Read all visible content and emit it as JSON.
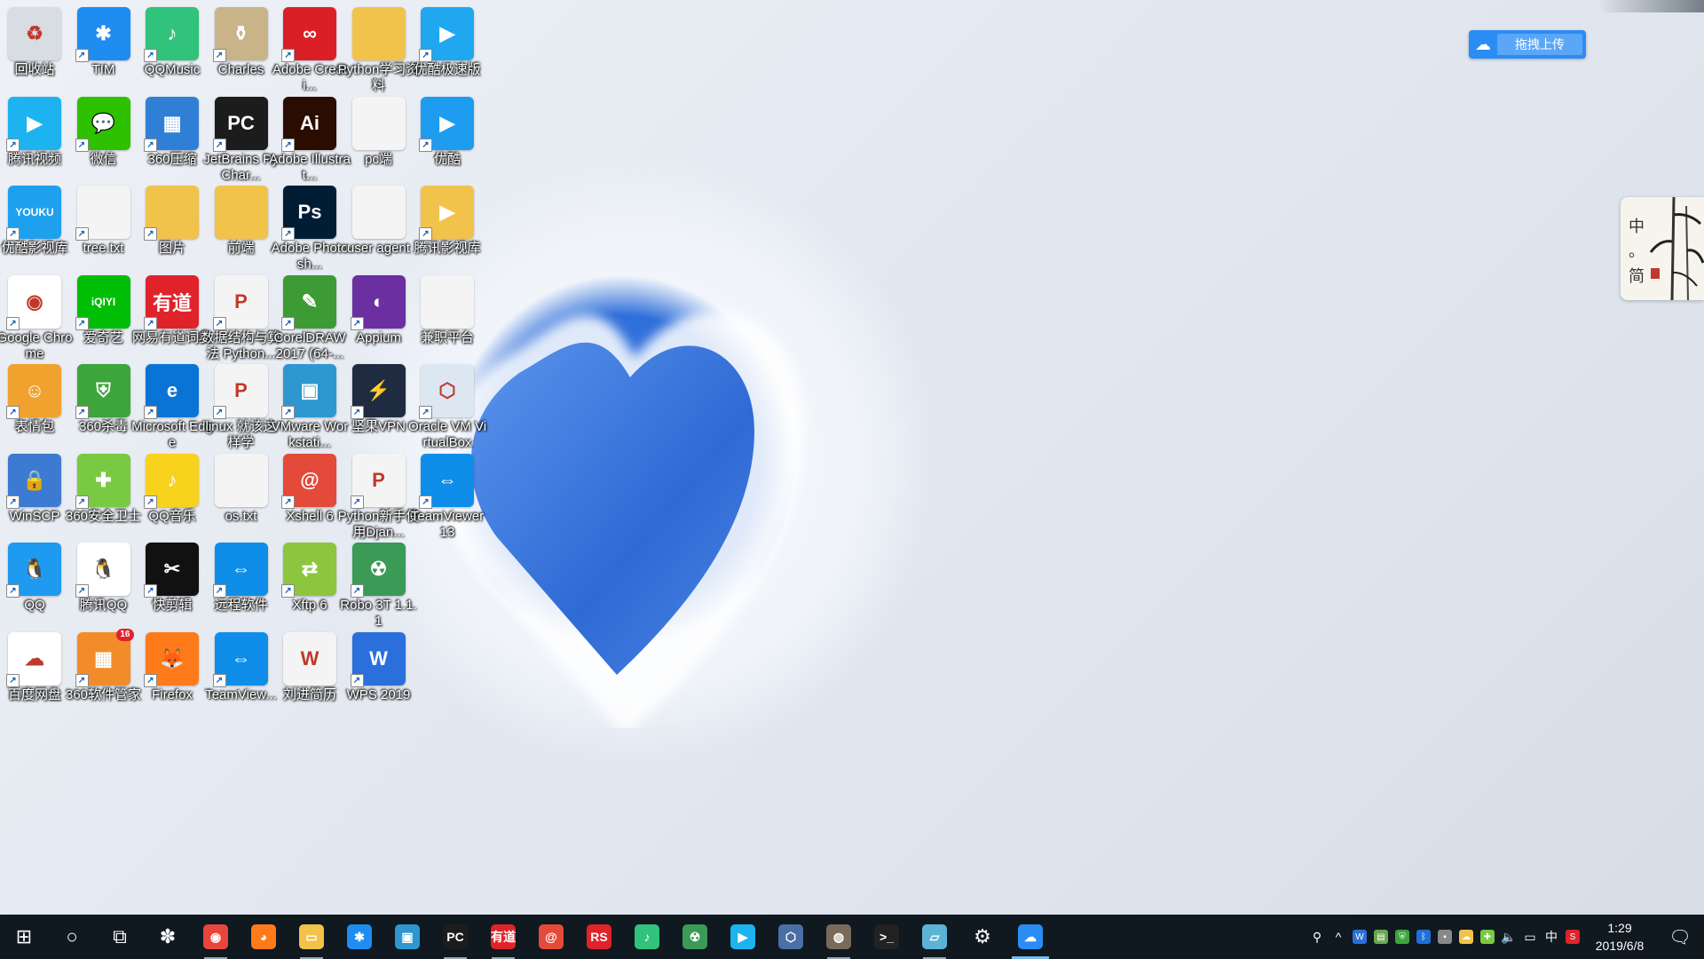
{
  "desktop": {
    "icons": [
      {
        "label": "回收站",
        "icon": "recycle-bin-icon",
        "color": "#d8dde3",
        "glyph": "♻",
        "shortcut": false
      },
      {
        "label": "TIM",
        "icon": "tim-icon",
        "color": "#1e8cf0",
        "glyph": "✱",
        "shortcut": true
      },
      {
        "label": "QQMusic",
        "icon": "qqmusic-icon",
        "color": "#31c27c",
        "glyph": "♪",
        "shortcut": true
      },
      {
        "label": "Charles",
        "icon": "charles-icon",
        "color": "#c9b48a",
        "glyph": "⚱",
        "shortcut": true
      },
      {
        "label": "Adobe Creati...",
        "icon": "adobe-creative-cloud-icon",
        "color": "#da1f26",
        "glyph": "∞",
        "shortcut": true
      },
      {
        "label": "Python学习资料",
        "icon": "folder-icon",
        "color": "#f1c34a",
        "glyph": "",
        "shortcut": false
      },
      {
        "label": "优酷极速版",
        "icon": "youku-express-icon",
        "color": "#1fa8f0",
        "glyph": "▶",
        "shortcut": true
      },
      {
        "label": "腾讯视频",
        "icon": "tencent-video-icon",
        "color": "#1db3f0",
        "glyph": "▶",
        "shortcut": true
      },
      {
        "label": "微信",
        "icon": "wechat-icon",
        "color": "#2dc100",
        "glyph": "💬",
        "shortcut": true
      },
      {
        "label": "360压缩",
        "icon": "360zip-icon",
        "color": "#2f7fd6",
        "glyph": "▦",
        "shortcut": true
      },
      {
        "label": "JetBrains PyChar...",
        "icon": "pycharm-icon",
        "color": "#1c1c1c",
        "glyph": "PC",
        "shortcut": true
      },
      {
        "label": "Adobe Illustrat...",
        "icon": "illustrator-icon",
        "color": "#2b0c00",
        "glyph": "Ai",
        "shortcut": true
      },
      {
        "label": "pc端",
        "icon": "file-icon",
        "color": "#f4f4f4",
        "glyph": "",
        "shortcut": false
      },
      {
        "label": "优酷",
        "icon": "youku-icon",
        "color": "#1d9cf0",
        "glyph": "▶",
        "shortcut": true
      },
      {
        "label": "优酷影视库",
        "icon": "youku-library-icon",
        "color": "#1fa0ef",
        "glyph": "YOUKU",
        "shortcut": true
      },
      {
        "label": "tree.txt",
        "icon": "text-file-icon",
        "color": "#f4f4f4",
        "glyph": "",
        "shortcut": true
      },
      {
        "label": "图片",
        "icon": "pictures-folder-icon",
        "color": "#f1c34a",
        "glyph": "",
        "shortcut": true
      },
      {
        "label": "前端",
        "icon": "zip-folder-icon",
        "color": "#f1c34a",
        "glyph": "",
        "shortcut": false
      },
      {
        "label": "Adobe Photosh...",
        "icon": "photoshop-icon",
        "color": "#001d34",
        "glyph": "Ps",
        "shortcut": true
      },
      {
        "label": "user agent",
        "icon": "file-icon",
        "color": "#f4f4f4",
        "glyph": "",
        "shortcut": false
      },
      {
        "label": "腾讯影视库",
        "icon": "tencent-video-library-icon",
        "color": "#f1c34a",
        "glyph": "▶",
        "shortcut": true
      },
      {
        "label": "Google Chrome",
        "icon": "chrome-icon",
        "color": "#ffffff",
        "glyph": "◉",
        "shortcut": true
      },
      {
        "label": "爱奇艺",
        "icon": "iqiyi-icon",
        "color": "#00be06",
        "glyph": "iQIYI",
        "shortcut": true
      },
      {
        "label": "网易有道词典",
        "icon": "youdao-icon",
        "color": "#e0232b",
        "glyph": "有道",
        "shortcut": true
      },
      {
        "label": "数据结构与算法 Python...",
        "icon": "pdf-icon",
        "color": "#f4f4f4",
        "glyph": "P",
        "shortcut": true
      },
      {
        "label": "CorelDRAW 2017 (64-...",
        "icon": "coreldraw-icon",
        "color": "#3d9b36",
        "glyph": "✎",
        "shortcut": true
      },
      {
        "label": "Appium",
        "icon": "appium-icon",
        "color": "#6b2fa1",
        "glyph": "◐",
        "shortcut": true
      },
      {
        "label": "兼职平台",
        "icon": "file-icon",
        "color": "#f4f4f4",
        "glyph": "",
        "shortcut": false
      },
      {
        "label": "表情包",
        "icon": "emoji-pack-icon",
        "color": "#f1a22e",
        "glyph": "☺",
        "shortcut": true
      },
      {
        "label": "360杀毒",
        "icon": "360antivirus-icon",
        "color": "#3da53b",
        "glyph": "⛨",
        "shortcut": true
      },
      {
        "label": "Microsoft Edge",
        "icon": "edge-icon",
        "color": "#0a74d6",
        "glyph": "e",
        "shortcut": true
      },
      {
        "label": "linux 就该这样学",
        "icon": "pdf-icon",
        "color": "#f4f4f4",
        "glyph": "P",
        "shortcut": true
      },
      {
        "label": "VMware Workstati...",
        "icon": "vmware-icon",
        "color": "#2f97d0",
        "glyph": "▣",
        "shortcut": true
      },
      {
        "label": "坚果VPN",
        "icon": "vpn-icon",
        "color": "#1f2b40",
        "glyph": "⚡",
        "shortcut": true
      },
      {
        "label": "Oracle VM VirtualBox",
        "icon": "virtualbox-icon",
        "color": "#dde7f2",
        "glyph": "⬡",
        "shortcut": true
      },
      {
        "label": "WinSCP",
        "icon": "winscp-icon",
        "color": "#3c7bd1",
        "glyph": "🔒",
        "shortcut": true
      },
      {
        "label": "360安全卫士",
        "icon": "360security-icon",
        "color": "#7ac943",
        "glyph": "✚",
        "shortcut": true
      },
      {
        "label": "QQ音乐",
        "icon": "qqmusic-icon",
        "color": "#f8d21c",
        "glyph": "♪",
        "shortcut": true
      },
      {
        "label": "os.txt",
        "icon": "text-file-icon",
        "color": "#f4f4f4",
        "glyph": "",
        "shortcut": false
      },
      {
        "label": "Xshell 6",
        "icon": "xshell-icon",
        "color": "#e34a3a",
        "glyph": "@",
        "shortcut": true
      },
      {
        "label": "Python新手使用Djan...",
        "icon": "pdf-icon",
        "color": "#f4f4f4",
        "glyph": "P",
        "shortcut": true
      },
      {
        "label": "TeamViewer 13",
        "icon": "teamviewer-icon",
        "color": "#0e8ee9",
        "glyph": "⇔",
        "shortcut": true
      },
      {
        "label": "QQ",
        "icon": "qq-icon",
        "color": "#1e9af0",
        "glyph": "🐧",
        "shortcut": true
      },
      {
        "label": "腾讯QQ",
        "icon": "tencent-qq-icon",
        "color": "#ffffff",
        "glyph": "🐧",
        "shortcut": true
      },
      {
        "label": "快剪辑",
        "icon": "kuaijianji-icon",
        "color": "#111111",
        "glyph": "✂",
        "shortcut": true
      },
      {
        "label": "远程软件",
        "icon": "remote-software-icon",
        "color": "#0e8ee9",
        "glyph": "⇔",
        "shortcut": true
      },
      {
        "label": "Xftp 6",
        "icon": "xftp-icon",
        "color": "#8cc63f",
        "glyph": "⇄",
        "shortcut": true
      },
      {
        "label": "Robo 3T 1.1.1",
        "icon": "robo3t-icon",
        "color": "#3a9a56",
        "glyph": "☢",
        "shortcut": true
      },
      {
        "label": "",
        "icon": "",
        "color": "",
        "glyph": "",
        "shortcut": false
      },
      {
        "label": "百度网盘",
        "icon": "baidu-netdisk-icon",
        "color": "#ffffff",
        "glyph": "☁",
        "shortcut": true
      },
      {
        "label": "360软件管家",
        "icon": "360softmanager-icon",
        "color": "#f28c2a",
        "glyph": "▦",
        "shortcut": true,
        "badge": "16"
      },
      {
        "label": "Firefox",
        "icon": "firefox-icon",
        "color": "#ff7a1a",
        "glyph": "🦊",
        "shortcut": true
      },
      {
        "label": "TeamView...",
        "icon": "teamviewer-icon",
        "color": "#0e8ee9",
        "glyph": "⇔",
        "shortcut": true
      },
      {
        "label": "刘进简历",
        "icon": "word-doc-icon",
        "color": "#f4f4f4",
        "glyph": "W",
        "shortcut": false
      },
      {
        "label": "WPS 2019",
        "icon": "wps-icon",
        "color": "#2a6fdb",
        "glyph": "W",
        "shortcut": true
      },
      {
        "label": "",
        "icon": "",
        "color": "",
        "glyph": "",
        "shortcut": false
      }
    ]
  },
  "upload_widget": {
    "label": "拖拽上传",
    "icon": "baidu-cloud-icon"
  },
  "ime_widget": {
    "chars": [
      "中",
      "。",
      "简"
    ]
  },
  "taskbar": {
    "items": [
      {
        "name": "start-button",
        "glyph": "⊞",
        "color": "",
        "state": ""
      },
      {
        "name": "search-button",
        "glyph": "○",
        "color": "",
        "state": ""
      },
      {
        "name": "task-view-button",
        "glyph": "⧉",
        "color": "",
        "state": ""
      },
      {
        "name": "taskbar-pinwheel-app",
        "glyph": "✽",
        "color": "",
        "state": ""
      },
      {
        "name": "taskbar-chrome",
        "glyph": "◉",
        "color": "#e8453c",
        "state": "open"
      },
      {
        "name": "taskbar-firefox",
        "glyph": "◕",
        "color": "#ff7a1a",
        "state": ""
      },
      {
        "name": "taskbar-file-explorer",
        "glyph": "▭",
        "color": "#f1c34a",
        "state": "open"
      },
      {
        "name": "taskbar-tim",
        "glyph": "✱",
        "color": "#1e8cf0",
        "state": ""
      },
      {
        "name": "taskbar-vmware",
        "glyph": "▣",
        "color": "#2f97d0",
        "state": ""
      },
      {
        "name": "taskbar-pycharm",
        "glyph": "PC",
        "color": "#1c1c1c",
        "state": "open"
      },
      {
        "name": "taskbar-youdao",
        "glyph": "有道",
        "color": "#e0232b",
        "state": "open"
      },
      {
        "name": "taskbar-xshell",
        "glyph": "@",
        "color": "#e34a3a",
        "state": ""
      },
      {
        "name": "taskbar-rs-app",
        "glyph": "RS",
        "color": "#e0232b",
        "state": ""
      },
      {
        "name": "taskbar-qqmusic",
        "glyph": "♪",
        "color": "#31c27c",
        "state": ""
      },
      {
        "name": "taskbar-robo3t",
        "glyph": "☢",
        "color": "#3a9a56",
        "state": ""
      },
      {
        "name": "taskbar-tencent-video",
        "glyph": "▶",
        "color": "#1db3f0",
        "state": ""
      },
      {
        "name": "taskbar-virtualbox",
        "glyph": "⬡",
        "color": "#4a6fa5",
        "state": ""
      },
      {
        "name": "taskbar-photo-app",
        "glyph": "◍",
        "color": "#7a6a5a",
        "state": "open"
      },
      {
        "name": "taskbar-terminal",
        "glyph": ">_",
        "color": "#222222",
        "state": ""
      },
      {
        "name": "taskbar-notebook-app",
        "glyph": "▱",
        "color": "#5cb3d6",
        "state": "open"
      },
      {
        "name": "taskbar-settings",
        "glyph": "⚙",
        "color": "",
        "state": ""
      },
      {
        "name": "taskbar-baidu-netdisk",
        "glyph": "☁",
        "color": "#2b8cf4",
        "state": "active"
      }
    ]
  },
  "tray": {
    "items": [
      {
        "name": "people-icon",
        "glyph": "⚲",
        "color": ""
      },
      {
        "name": "show-hidden-icons-chevron",
        "glyph": "^",
        "color": ""
      },
      {
        "name": "tray-app-w-icon",
        "glyph": "W",
        "color": "#2a6fdb"
      },
      {
        "name": "tray-network-app-icon",
        "glyph": "▤",
        "color": "#6aa84f"
      },
      {
        "name": "tray-360-shield-icon",
        "glyph": "⛨",
        "color": "#3da53b"
      },
      {
        "name": "bluetooth-icon",
        "glyph": "ᛒ",
        "color": "#1e6fd8"
      },
      {
        "name": "tray-devices-icon",
        "glyph": "▪",
        "color": "#888888"
      },
      {
        "name": "tray-cloud-app-icon",
        "glyph": "☁",
        "color": "#f1c34a"
      },
      {
        "name": "tray-360-guard-icon",
        "glyph": "✚",
        "color": "#7ac943"
      },
      {
        "name": "volume-icon",
        "glyph": "🔈",
        "color": ""
      },
      {
        "name": "network-icon",
        "glyph": "▭",
        "color": ""
      },
      {
        "name": "ime-indicator",
        "glyph": "中",
        "color": ""
      },
      {
        "name": "sogou-ime-icon",
        "glyph": "S",
        "color": "#e0232b"
      }
    ],
    "time": "1:29",
    "date": "2019/6/8"
  }
}
